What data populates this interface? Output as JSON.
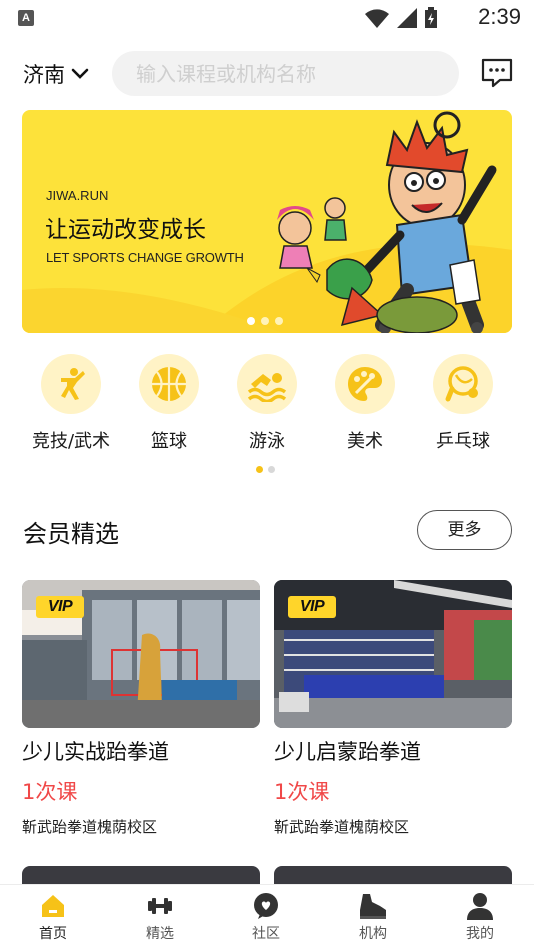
{
  "status_bar": {
    "time": "2:39",
    "notification_icon": "A"
  },
  "header": {
    "city": "济南",
    "search_placeholder": "输入课程或机构名称"
  },
  "banner": {
    "subtitle": "JIWA.RUN",
    "title": "让运动改变成长",
    "title_en": "LET SPORTS CHANGE GROWTH",
    "slide_count": 3,
    "active_slide": 1
  },
  "categories": [
    {
      "label": "竞技/武术",
      "icon": "martial-arts-icon"
    },
    {
      "label": "篮球",
      "icon": "basketball-icon"
    },
    {
      "label": "游泳",
      "icon": "swimming-icon"
    },
    {
      "label": "美术",
      "icon": "palette-icon"
    },
    {
      "label": "乒乓球",
      "icon": "pingpong-icon"
    }
  ],
  "members_section": {
    "title": "会员精选",
    "more_label": "更多",
    "cards": [
      {
        "badge": "VIP",
        "name": "少儿实战跆拳道",
        "lessons": "1次课",
        "org": "靳武跆拳道槐荫校区"
      },
      {
        "badge": "VIP",
        "name": "少儿启蒙跆拳道",
        "lessons": "1次课",
        "org": "靳武跆拳道槐荫校区"
      }
    ]
  },
  "tabbar": {
    "tabs": [
      {
        "label": "首页",
        "icon": "home-icon",
        "active": true
      },
      {
        "label": "精选",
        "icon": "dumbbell-icon",
        "active": false
      },
      {
        "label": "社区",
        "icon": "chat-bubble-icon",
        "active": false
      },
      {
        "label": "机构",
        "icon": "shoe-icon",
        "active": false
      },
      {
        "label": "我的",
        "icon": "person-icon",
        "active": false
      }
    ]
  },
  "colors": {
    "accent": "#f6c218",
    "banner_bg": "#fde23a",
    "price_red": "#f04848",
    "icon_circle": "#fff3c6"
  }
}
